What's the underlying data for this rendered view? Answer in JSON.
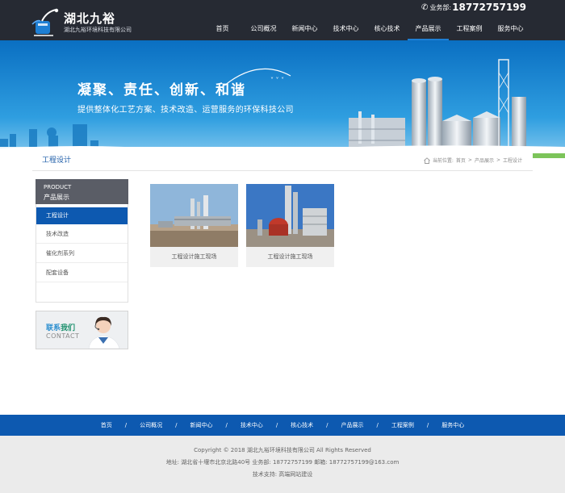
{
  "brand": {
    "name": "湖北九裕",
    "subtitle": "湖北九裕环境科技有限公司"
  },
  "hotline": {
    "icon": "phone-icon",
    "label": "业务部:",
    "number": "18772757199"
  },
  "nav": {
    "items": [
      {
        "label": "首页"
      },
      {
        "label": "公司概况"
      },
      {
        "label": "新闻中心"
      },
      {
        "label": "技术中心"
      },
      {
        "label": "核心技术"
      },
      {
        "label": "产品展示",
        "active": true
      },
      {
        "label": "工程案例"
      },
      {
        "label": "服务中心"
      }
    ]
  },
  "banner": {
    "headline": "凝聚、责任、创新、和谐",
    "subline": "提供整体化工艺方案、技术改造、运营服务的环保科技公司"
  },
  "breadcrumb": {
    "title": "工程设计",
    "prefix": "当前位置:",
    "path": [
      "首页",
      ">",
      "产品展示",
      ">",
      "工程设计"
    ]
  },
  "sidebar": {
    "head_en": "PRODUCT",
    "head_cn": "产品展示",
    "items": [
      {
        "label": "工程设计",
        "active": true
      },
      {
        "label": "技术改造"
      },
      {
        "label": "催化剂系列"
      },
      {
        "label": "配套设备"
      }
    ],
    "contact_cn_1": "联系",
    "contact_cn_2": "我们",
    "contact_en": "CONTACT"
  },
  "products": [
    {
      "caption": "工程设计施工现场"
    },
    {
      "caption": "工程设计施工现场"
    }
  ],
  "footer": {
    "nav": [
      "首页",
      "公司概况",
      "新闻中心",
      "技术中心",
      "核心技术",
      "产品展示",
      "工程案例",
      "服务中心"
    ],
    "separator": "/",
    "copyright": "Copyright © 2018 湖北九裕环境科技有限公司 All Rights Reserved",
    "address": "地址: 湖北省十堰市北京北路40号 业务部: 18772757199 邮箱: 18772757199@163.com",
    "support": "技术支持: 高端网站建设"
  },
  "colors": {
    "header_bg": "#262a33",
    "accent_blue": "#0d59b0",
    "footer_bg": "#ebebeb"
  }
}
